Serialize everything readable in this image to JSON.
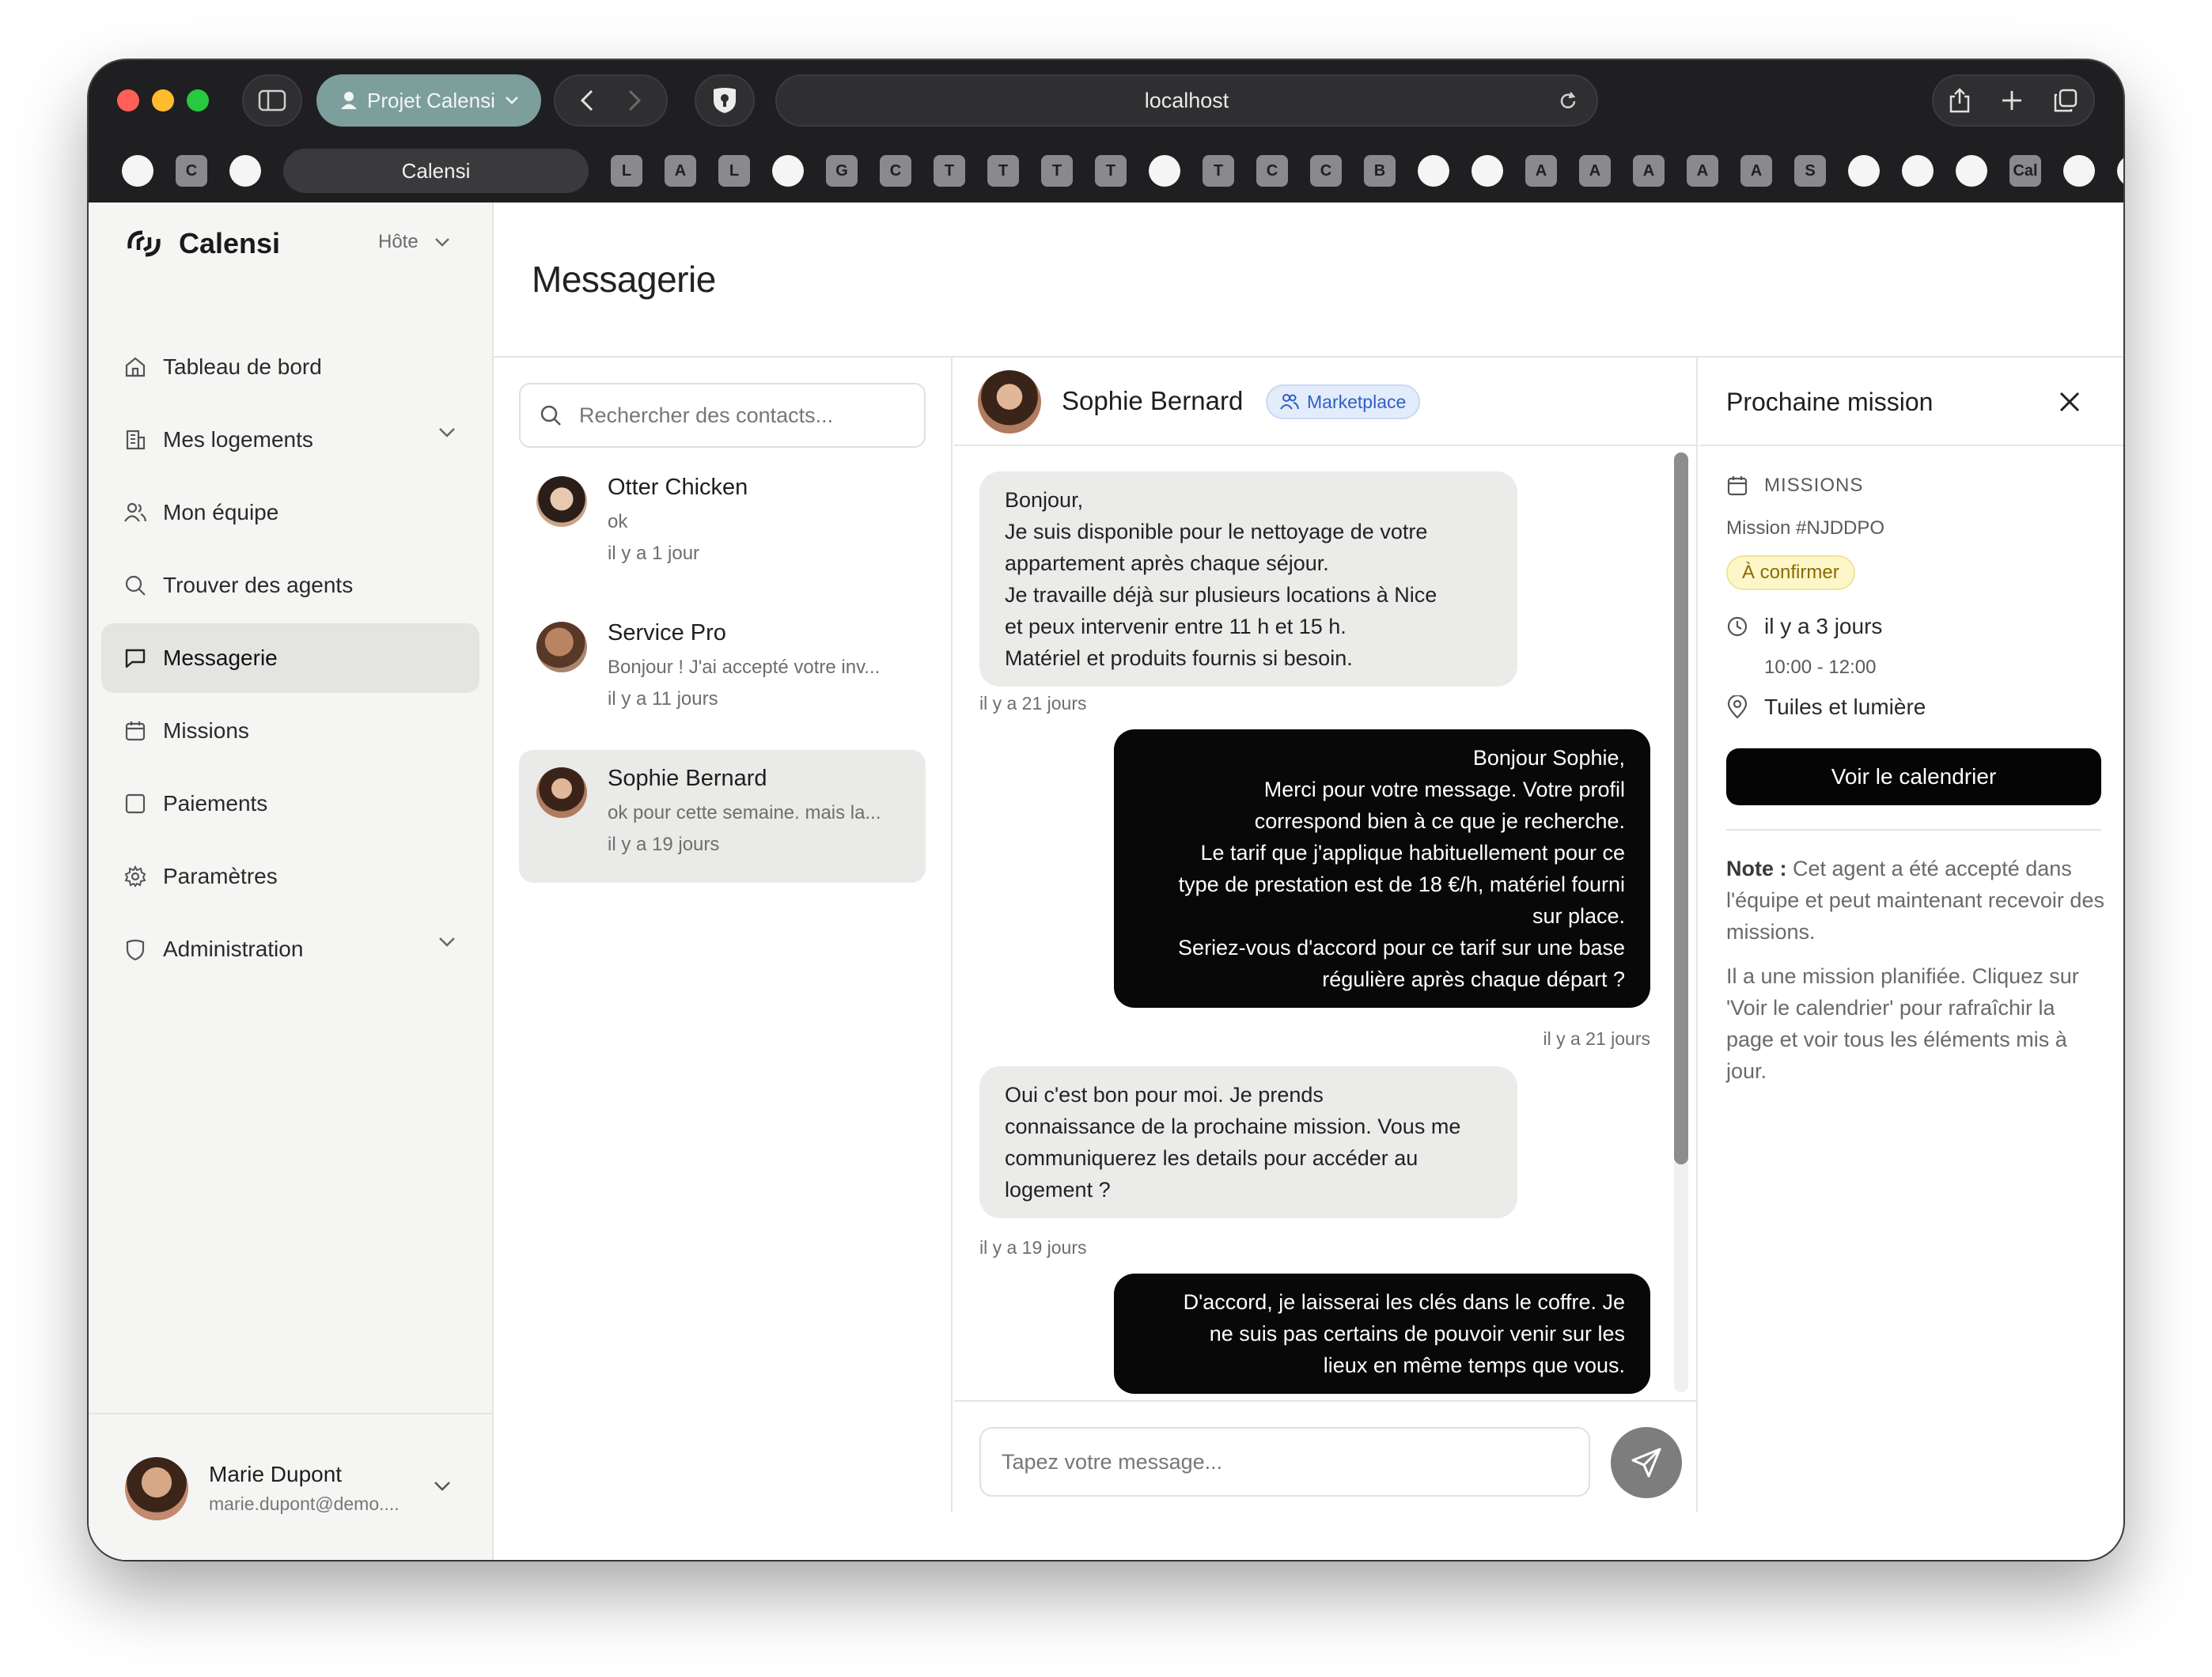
{
  "browser": {
    "project_label": "Projet Calensi",
    "url": "localhost",
    "active_tab": "Calensi",
    "bookmarks": [
      "",
      "C",
      "",
      "L",
      "A",
      "L",
      "",
      "G",
      "C",
      "T",
      "T",
      "T",
      "T",
      "",
      "T",
      "C",
      "C",
      "B",
      "",
      "",
      "A",
      "A",
      "A",
      "A",
      "A",
      "S",
      "",
      "",
      "",
      "Cal",
      "",
      ""
    ]
  },
  "sidebar": {
    "brand": "Calensi",
    "role": "Hôte",
    "items": [
      {
        "label": "Tableau de bord",
        "icon": "home-icon"
      },
      {
        "label": "Mes logements",
        "icon": "building-icon",
        "expandable": true
      },
      {
        "label": "Mon équipe",
        "icon": "users-icon"
      },
      {
        "label": "Trouver des agents",
        "icon": "search-icon"
      },
      {
        "label": "Messagerie",
        "icon": "message-icon",
        "active": true
      },
      {
        "label": "Missions",
        "icon": "calendar-icon"
      },
      {
        "label": "Paiements",
        "icon": "square-icon"
      },
      {
        "label": "Paramètres",
        "icon": "gear-icon"
      },
      {
        "label": "Administration",
        "icon": "shield-icon",
        "expandable": true
      }
    ],
    "user": {
      "name": "Marie Dupont",
      "email": "marie.dupont@demo...."
    }
  },
  "page": {
    "title": "Messagerie"
  },
  "contacts": {
    "search_placeholder": "Rechercher des contacts...",
    "list": [
      {
        "name": "Otter Chicken",
        "preview": "ok",
        "time": "il y a 1 jour"
      },
      {
        "name": "Service Pro",
        "preview": "Bonjour ! J'ai accepté votre inv...",
        "time": "il y a 11 jours"
      },
      {
        "name": "Sophie Bernard",
        "preview": "ok pour cette semaine. mais la...",
        "time": "il y a 19 jours",
        "active": true
      }
    ]
  },
  "chat": {
    "contact_name": "Sophie Bernard",
    "badge": "Marketplace",
    "messages": [
      {
        "dir": "in",
        "lines": [
          "Bonjour,",
          "Je suis disponible pour le nettoyage de votre",
          "appartement après chaque séjour.",
          "Je travaille déjà sur plusieurs locations à Nice",
          "et peux intervenir entre 11 h et 15 h.",
          "Matériel et produits fournis si besoin."
        ],
        "time": "il y a 21 jours"
      },
      {
        "dir": "out",
        "lines": [
          "Bonjour Sophie,",
          "Merci pour votre message. Votre profil",
          "correspond bien à ce que je recherche.",
          "Le tarif que j'applique habituellement pour ce",
          "type de prestation est de 18 €/h, matériel fourni",
          "sur place.",
          "Seriez-vous d'accord pour ce tarif sur une base",
          "régulière après chaque départ ?"
        ],
        "time": "il y a 21 jours"
      },
      {
        "dir": "in",
        "lines": [
          "Oui c'est bon pour moi. Je prends",
          "connaissance de la prochaine mission. Vous me",
          "communiquerez les details pour accéder au",
          "logement ?"
        ],
        "time": "il y a 19 jours"
      },
      {
        "dir": "out",
        "lines": [
          "D'accord, je laisserai les clés dans le coffre. Je",
          "ne suis pas certains de pouvoir venir sur les",
          "lieux en même temps que vous."
        ],
        "time": ""
      }
    ],
    "input_placeholder": "Tapez votre message..."
  },
  "panel": {
    "title": "Prochaine mission",
    "section": "MISSIONS",
    "mission_id": "Mission #NJDDPO",
    "status": "À confirmer",
    "when": "il y a 3 jours",
    "hours": "10:00 - 12:00",
    "place": "Tuiles et lumière",
    "button": "Voir le calendrier",
    "note_label": "Note :",
    "note_text": "Cet agent a été accepté dans l'équipe et peut maintenant recevoir des missions.",
    "note2": "Il a une mission planifiée. Cliquez sur 'Voir le calendrier' pour rafraîchir la page et voir tous les éléments mis à jour."
  },
  "colors": {
    "accent": "#7d9f9b",
    "outgoing": "#080808",
    "incoming": "#ebebea",
    "badge": "#2f5fc4",
    "status": "#8a6a00"
  }
}
